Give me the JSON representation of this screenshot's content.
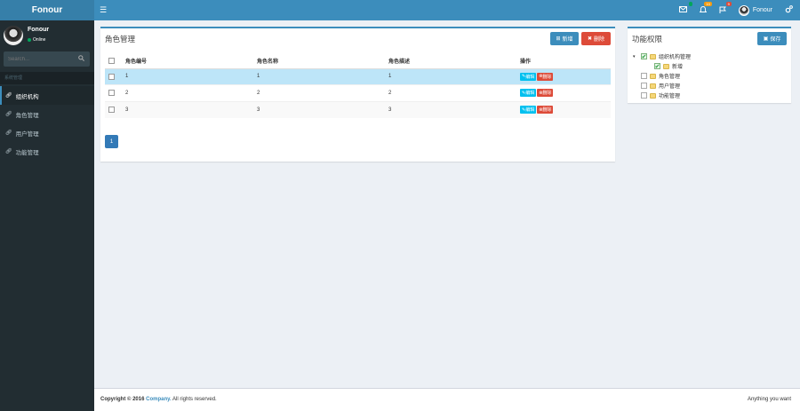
{
  "app": {
    "logo": "Fonour"
  },
  "header": {
    "badges": {
      "mail": "",
      "notifications": "10",
      "flags": "9"
    },
    "user": "Fonour"
  },
  "sidebar": {
    "user": {
      "name": "Fonour",
      "status": "Online"
    },
    "search_placeholder": "Search...",
    "section_header": "系统管理",
    "items": [
      {
        "label": "组织机构",
        "active": true
      },
      {
        "label": "角色管理"
      },
      {
        "label": "用户管理"
      },
      {
        "label": "功能管理"
      }
    ]
  },
  "roles": {
    "title": "角色管理",
    "add_label": "新增",
    "delete_label": "删除",
    "columns": [
      "角色编号",
      "角色名称",
      "角色描述",
      "操作"
    ],
    "rows": [
      {
        "code": "1",
        "name": "1",
        "desc": "1"
      },
      {
        "code": "2",
        "name": "2",
        "desc": "2"
      },
      {
        "code": "3",
        "name": "3",
        "desc": "3"
      }
    ],
    "edit_label": "编辑",
    "row_delete_label": "删除",
    "page": "1"
  },
  "perms": {
    "title": "功能权限",
    "save_label": "保存",
    "tree": [
      {
        "label": "组织机构管理",
        "checked": true,
        "level": 0
      },
      {
        "label": "新增",
        "checked": true,
        "level": 1
      },
      {
        "label": "角色管理",
        "checked": false,
        "level": 0
      },
      {
        "label": "用户管理",
        "checked": false,
        "level": 0
      },
      {
        "label": "功能管理",
        "checked": false,
        "level": 0
      }
    ]
  },
  "footer": {
    "copyright": "Copyright © 2016 ",
    "company": "Company.",
    "rights": " All rights reserved.",
    "tagline": "Anything you want"
  },
  "colors": {
    "brand": "#3c8dbc",
    "sidebar": "#222d32",
    "danger": "#dd4b39",
    "info": "#00c0ef",
    "selected_row": "#bde5f8"
  }
}
